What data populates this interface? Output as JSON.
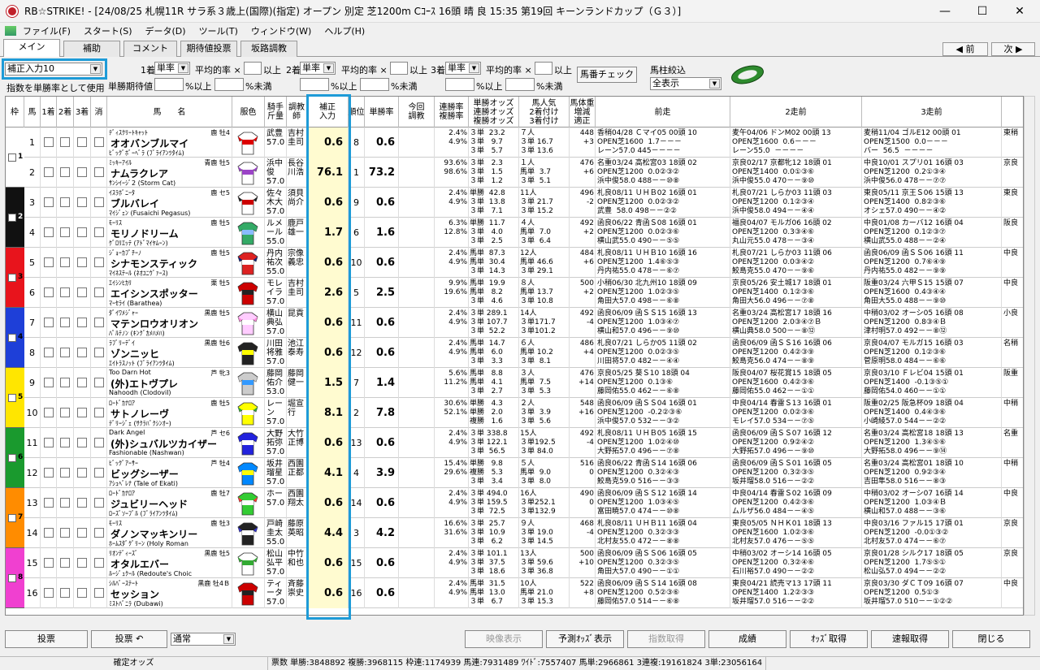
{
  "window": {
    "title": "RB☆STRIKE! - [24/08/25 札幌11R サラ系３歳上(国際)(指定) オープン 別定 芝1200m Cｺｰｽ 16頭 晴 良 15:35 第19回 キーンランドカップ（Ｇ３）]",
    "min": "—",
    "max": "☐",
    "close": "✕"
  },
  "menu": [
    "ファイル(F)",
    "スタート(S)",
    "データ(D)",
    "ツール(T)",
    "ウィンドウ(W)",
    "ヘルプ(H)"
  ],
  "tabs": [
    "メイン",
    "補助",
    "コメント",
    "期待値投票",
    "坂路調教"
  ],
  "nav": {
    "prev": "◀ 前",
    "next": "次 ▶"
  },
  "controls": {
    "index_select": "補正入力10",
    "use_as_odds": "指数を単勝率として使用",
    "place1": "1着",
    "place2": "2着",
    "place3": "3着",
    "bet1": "単率",
    "bet2": "単率",
    "bet3": "単率",
    "avg_label": "平均的率 ×",
    "over": "以上",
    "exp_label": "単勝期待値",
    "pct_over": "%以上",
    "pct_under": "%未満",
    "check_btn": "馬番チェック",
    "filter_label": "馬柱絞込",
    "filter_select": "全表示"
  },
  "headers": {
    "waku": "枠",
    "uma": "馬",
    "p1": "1着",
    "p2": "2着",
    "p3": "3着",
    "kesu": "消",
    "horse": "馬　　名",
    "silk": "服色",
    "jockey": "騎手\n斤量",
    "trainer": "調教\n師",
    "index": "補正\n入力",
    "rank": "順位",
    "win": "単勝率",
    "today": "今回\n調教",
    "rate": "連勝率\n複勝率",
    "odds_type": "単勝オッズ\n連勝オッズ\n複勝オッズ",
    "pop": "馬人気\n2着付け\n3着付け",
    "wt": "馬体重\n増減\n適正",
    "prev1": "前走",
    "prev2": "2走前",
    "prev3": "3走前"
  },
  "horses": [
    {
      "waku": "1",
      "num": "1",
      "sire": "ﾃﾞｨｽｸﾘｰﾄｷｬｯﾄ",
      "sex": "鹿 牡4",
      "name": "オオバンブルマイ",
      "dam": "ﾋﾞｯｸﾞﾎﾞｰﾍﾞﾗ (ﾌﾞﾗｲｱﾝﾂﾀｲﾑ)",
      "jockey": "武豊",
      "kin": "57.0",
      "trainer": "吉村\n圭司",
      "index": "0.6",
      "rank": "8",
      "win": "0.6",
      "rate": "2.4%\n4.9%",
      "odds": "３単  23.2\n３単   9.7\n３単   5.7",
      "pop": "７人\n３単 16.7\n３単 13.6",
      "wt": "448\n+3",
      "p1": "香稍04/28 Ｃマイ05 00頭 10\nOPEN芝1600  1.7－－－\nレーン57.0 445－－－－",
      "p2": "麦午04/06 ドンM02 00頭 13\nOPEN芝1600  0.6－－－\nレーン55.0  －－－－",
      "p3": "麦稍11/04 ゴルE12 00頭 01\nOPEN芝1500  0.0－－－\nバー  56.5  －－－－"
    },
    {
      "waku": "1",
      "num": "2",
      "sire": "ﾐｯｷｰｱｲﾙ",
      "sex": "青鹿 牡5",
      "name": "ナムラクレア",
      "dam": "ｻﾝｼｲｰｼﾞ2 (Storm Cat)",
      "jockey": "浜中\n俊",
      "kin": "57.0",
      "trainer": "長谷\n川浩",
      "index": "76.1",
      "rank": "1",
      "win": "73.2",
      "rate": "93.6%\n98.6%",
      "odds": "３単   2.3\n３単   1.5\n３単   1.2",
      "pop": "１人\n馬単  3.7\n３単  5.1",
      "wt": "476\n+6",
      "p1": "名重03/24 高松宮03 18頭 02\nOPEN芝1200  0.0②③②\n浜中俊58.0 488－－⑩⑧",
      "p2": "京良02/17 京都牝12 18頭 01\nOPEN芝1400  0.0①③⑥\n浜中俊55.0 470－－⑨⑩",
      "p3": "中良10/01 スプリ01 16頭 03\nOPEN芝1200  0.2①③④\n浜中俊56.0 478－－⑦⑦"
    },
    {
      "waku": "2",
      "num": "3",
      "sire": "ｲｽﾗﾎﾞﾆｰﾀ",
      "sex": "鹿 セ5",
      "name": "ブルバレイ",
      "dam": "ﾏｲｼﾞｪﾝ (Fusaichi Pegasus)",
      "jockey": "佐々\n木大",
      "kin": "57.0",
      "trainer": "須貝\n尚介",
      "index": "0.6",
      "rank": "9",
      "win": "0.6",
      "rate": "2.4%\n4.9%",
      "odds": "単勝  42.8\n３単  13.8\n３単   7.1",
      "pop": "11人\n３単 21.7\n３単 15.2",
      "wt": "496\n-2",
      "p1": "札良08/11 ＵＨＢ02 16頭 01\nOPEN芝1200  0.0②③②\n武豊  58.0 498－－②②",
      "p2": "札良07/21 しらか03 11頭 03\nOPEN芝1200  0.1②③④\n浜中俊58.0 494－－④④",
      "p3": "東良05/11 京王Ｓ06 15頭 13\nOPEN芝1400  0.8②③⑥\nオシェ57.0 490－－④②"
    },
    {
      "waku": "2",
      "num": "4",
      "sire": "ﾓｰﾘｽ",
      "sex": "鹿 牡5",
      "name": "モリノドリーム",
      "dam": "ｹﾞﾛﾘｴｯﾃ (ｱﾄﾞﾏｲﾔﾑｰﾝ)",
      "jockey": "ルメ\nール",
      "kin": "55.0",
      "trainer": "鹿戸\n雄一",
      "index": "1.7",
      "rank": "6",
      "win": "1.6",
      "rate": "6.3%\n12.8%",
      "odds": "単勝  11.7\n３単   4.0\n３単   2.5",
      "pop": "４人\n馬単  7.0\n３単  6.4",
      "wt": "492\n+2",
      "p1": "函良06/22 青函Ｓ08 16頭 01\nOPEN芝1200  0.0②③⑥\n横山武55.0 490－－⑤⑤",
      "p2": "福良04/07 モルガ06 16頭 02\nOPEN芝1200  0.3③④⑥\n丸山元55.0 478－－③④",
      "p3": "中良01/08 カーバ12 16頭 04\nOPEN芝1200  0.1②③⑦\n横山武55.0 488－－②④"
    },
    {
      "waku": "3",
      "num": "5",
      "sire": "ｼﾞｮｰｶﾌﾟﾁｰﾉ",
      "sex": "鹿 牡5",
      "name": "シナモンスティック",
      "dam": "ﾏｲﾈｽﾃｰﾙ (ﾈｵﾕﾆｳﾞｧｰｽ)",
      "jockey": "丹内\n祐次",
      "kin": "55.0",
      "trainer": "宗像\n義忠",
      "index": "0.6",
      "rank": "10",
      "win": "0.6",
      "rate": "2.4%\n4.9%",
      "odds": "馬単  87.3\n馬単  30.4\n３単  14.3",
      "pop": "12人\n馬単 46.6\n３単 29.1",
      "wt": "484\n+6",
      "p1": "札良08/11 ＵＨＢ10 16頭 16\nOPEN芝1200  1.4⑥⑤③\n丹内祐55.0 478－－⑥⑦",
      "p2": "札良07/21 しらか03 11頭 06\nOPEN芝1200  0.0③④②\n鮫島克55.0 470－－⑨⑥",
      "p3": "函良06/09 函ＳＳ06 16頭 11\nOPEN芝1200  0.7⑥④⑨\n丹内祐55.0 482－－⑨⑨"
    },
    {
      "waku": "3",
      "num": "6",
      "sire": "ｴｲｼﾝﾋｶﾘ",
      "sex": "栗 牡5",
      "name": "エイシンスポッター",
      "dam": "ﾏｰｾﾗｲ (Barathea)",
      "jockey": "モレ\nイラ",
      "kin": "57.0",
      "trainer": "吉村\n圭司",
      "index": "2.6",
      "rank": "5",
      "win": "2.5",
      "rate": "9.9%\n19.6%",
      "odds": "馬単  19.9\n馬単   8.2\n３単   4.6",
      "pop": "８人\n馬単 13.7\n３単 10.8",
      "wt": "500\n+2",
      "p1": "小稍06/30 北九州10 18頭 09\nOPEN芝1200  1.0②③⑤\n角田大57.0 498－－⑥⑧",
      "p2": "京良05/26 安土城17 18頭 01\nOPEN芝1400  0.1②③⑥\n角田大56.0 496－－⑦⑧",
      "p3": "阪重03/24 六甲Ｓ15 15頭 07\nOPEN芝1600  0.4③④④\n角田大55.0 488－－⑨⑩"
    },
    {
      "waku": "4",
      "num": "7",
      "sire": "ﾀﾞｲﾜﾒｼﾞｬｰ",
      "sex": "黒鹿 牡5",
      "name": "マテンロウオリオン",
      "dam": "ﾊﾟﾙﾃﾉﾝ (ｷﾝｸﾞｶﾒﾊﾒﾊ)",
      "jockey": "横山\n典弘",
      "kin": "57.0",
      "trainer": "昆貢",
      "index": "0.6",
      "rank": "11",
      "win": "0.6",
      "rate": "2.4%\n4.9%",
      "odds": "３単 289.1\n３単 107.7\n３単  52.2",
      "pop": "14人\n３単171.7\n３単101.2",
      "wt": "492\n-4",
      "p1": "函良06/09 函ＳＳ15 16頭 13\nOPEN芝1200  1.0③④⑦\n横山和57.0 496－－⑨⑩",
      "p2": "名重03/24 高松宮17 18頭 16\nOPEN芝1200  2.0③④⑦Ｂ\n横山典58.0 500－－⑧⑫",
      "p3": "中稍03/02 オーシ05 16頭 08\nOPEN芝1200  0.8③④Ｂ\n津村明57.0 492－－⑧⑫"
    },
    {
      "waku": "4",
      "num": "8",
      "sire": "ﾗﾌﾞﾘｰﾃﾞｲ",
      "sex": "黒鹿 牡6",
      "name": "ゾンニッヒ",
      "dam": "ｴｲﾄﾗｽﾉｯﾄ (ﾌﾞﾗｲｱﾝﾂﾀｲﾑ)",
      "jockey": "川田\n将雅",
      "kin": "57.0",
      "trainer": "池江\n泰寿",
      "index": "0.6",
      "rank": "12",
      "win": "0.6",
      "rate": "2.4%\n4.9%",
      "odds": "馬単  14.7\n馬単   6.0\n３単   3.3",
      "pop": "６人\n馬単 10.2\n３単  8.1",
      "wt": "486\n+4",
      "p1": "札良07/21 しらか05 11頭 02\nOPEN芝1200  0.0②③⑤\n川田将57.0 482－－④④",
      "p2": "函良06/09 函ＳＳ16 16頭 06\nOPEN芝1200  0.4②③⑨\n鮫島克56.0 474－－⑧⑨",
      "p3": "京良04/07 モルガ15 16頭 03\nOPEN芝1200  0.1②③⑥\n菅原明58.0 484－－⑥⑥"
    },
    {
      "waku": "5",
      "num": "9",
      "sire": "Too Darn Hot",
      "sex": "芦 牝3",
      "name": "(外)エトヴプレ",
      "dam": "Nahoodh (Clodovil)",
      "jockey": "藤岡\n佑介",
      "kin": "53.0",
      "trainer": "藤岡\n健一",
      "index": "1.5",
      "rank": "7",
      "win": "1.4",
      "rate": "5.6%\n11.2%",
      "odds": "馬単   8.8\n馬単   4.1\n３単   2.7",
      "pop": "３人\n馬単  7.5\n３単  5.3",
      "wt": "476\n+14",
      "p1": "京良05/25 葵Ｓ10 18頭 04\nOPEN芝1200  0.1③⑥\n藤岡佑55.0 462－－⑥⑧",
      "p2": "阪良04/07 桜花賞15 18頭 05\nOPEN芝1600  0.4②③⑥\n藤岡佑55.0 462－－①①",
      "p3": "京良03/10 Ｆレビ04 15頭 01\nOPEN芝1400  -0.1③⑤①\n藤岡佑54.0 460－－①①"
    },
    {
      "waku": "5",
      "num": "10",
      "sire": "ﾛｰﾄﾞｶﾅﾛｱ",
      "sex": "鹿 牡5",
      "name": "サトノレーヴ",
      "dam": "ﾃﾞﾘｰｼﾞｪ (ｻｸﾗﾊﾞｸｼﾝｵｰ)",
      "jockey": "レー\nン",
      "kin": "57.0",
      "trainer": "堀宣\n行",
      "index": "8.1",
      "rank": "2",
      "win": "7.8",
      "rate": "30.6%\n52.1%",
      "odds": "単勝   4.3\n単勝   2.0\n複勝   1.6",
      "pop": "２人\n３単  3.9\n３単  5.6",
      "wt": "548\n+16",
      "p1": "函良06/09 函ＳＳ04 16頭 01\nOPEN芝1200  -0.2②③⑥\n浜中俊57.0 532－－③②",
      "p2": "中良04/14 春雷Ｓ13 16頭 01\nOPEN芝1200  0.0②③⑥\nモレイ57.0 534－－⑦⑤",
      "p3": "阪重02/25 阪急杯09 18頭 04\nOPEN芝1400  0.4④③⑥\n小崎綾57.0 544－－②②"
    },
    {
      "waku": "6",
      "num": "11",
      "sire": "Dark Angel",
      "sex": "芦 セ6",
      "name": "(外)シュバルツカイザー",
      "dam": "Fashionable (Nashwan)",
      "jockey": "大野\n拓弥",
      "kin": "57.0",
      "trainer": "大竹\n正博",
      "index": "0.6",
      "rank": "13",
      "win": "0.6",
      "rate": "2.4%\n4.9%",
      "odds": "３単 338.8\n３単 122.1\n３単  56.5",
      "pop": "15人\n３単192.5\n３単 84.0",
      "wt": "492\n-4",
      "p1": "札良08/11 ＵＨＢ05 16頭 15\nOPEN芝1200  1.0②④⑩\n大野拓57.0 496－－⑦⑧",
      "p2": "函良06/09 函ＳＳ07 16頭 12\nOPEN芝1200  0.9②④②\n大野拓57.0 496－－⑨⑩",
      "p3": "名重03/24 高松宮18 18頭 13\nOPEN芝1200  1.3④⑤⑥\n大野拓58.0 496－－⑨⑭"
    },
    {
      "waku": "6",
      "num": "12",
      "sire": "ﾋﾞｯｸﾞｱｰｻｰ",
      "sex": "芦 牡4",
      "name": "ビッグシーザー",
      "dam": "ｱｼｭﾍﾞﾚﾅ (Tale of Ekati)",
      "jockey": "坂井\n瑠星",
      "kin": "57.0",
      "trainer": "西園\n正都",
      "index": "4.1",
      "rank": "4",
      "win": "3.9",
      "rate": "15.4%\n29.6%",
      "odds": "単勝   9.8\n複勝   5.3\n３単   3.4",
      "pop": "５人\n馬単  9.0\n３単  8.0",
      "wt": "516\n0",
      "p1": "函良06/22 青函Ｓ14 16頭 06\nOPEN芝1200  0.3②④③\n鮫島克59.0 516－－③③",
      "p2": "函良06/09 函ＳＳ01 16頭 05\nOPEN芝1200  0.3②③⑤\n坂井瑠58.0 516－－②②",
      "p3": "名重03/24 高松宮01 18頭 10\nOPEN芝1200  0.9②③④\n吉田隼58.0 516－－⑧③"
    },
    {
      "waku": "7",
      "num": "13",
      "sire": "ﾛｰﾄﾞｶﾅﾛｱ",
      "sex": "鹿 牡7",
      "name": "ジュビリーヘッド",
      "dam": "ﾛｰｽﾞｿｰﾌﾞﾙ (ﾌﾞﾗｲｱﾝﾂﾀｲﾑ)",
      "jockey": "ホー",
      "kin": "57.0",
      "trainer": "西園\n翔太",
      "index": "0.6",
      "rank": "14",
      "win": "0.6",
      "rate": "2.4%\n4.9%",
      "odds": "３単 494.0\n３単 159.5\n３単  72.5",
      "pop": "16人\n３単252.1\n３単132.9",
      "wt": "490\n0",
      "p1": "函良06/09 函ＳＳ12 16頭 14\nOPEN芝1200  1.0③④⑤\n富田暁57.0 474－－⑩⑧",
      "p2": "中良04/14 春雷Ｓ02 16頭 09\nOPEN芝1200  0.4②③⑥\nムルザ56.0 484－－④⑤",
      "p3": "中稍03/02 オーシ07 16頭 14\nOPEN芝1200  1.0③④Ｂ\n横山和57.0 488－－③⑥"
    },
    {
      "waku": "7",
      "num": "14",
      "sire": "ﾓｰﾘｽ",
      "sex": "鹿 牡3",
      "name": "ダノンマッキンリー",
      "dam": "ﾎｰﾑｽﾀﾞｸﾞﾘｰﾝ (Holy Roman",
      "jockey": "戸崎\n圭太",
      "kin": "55.0",
      "trainer": "藤原\n英昭",
      "index": "4.4",
      "rank": "3",
      "win": "4.2",
      "rate": "16.6%\n31.6%",
      "odds": "３単  25.7\n３単  10.9\n３単   6.2",
      "pop": "９人\n３単 19.0\n３単 14.5",
      "wt": "468\n-4",
      "p1": "札良08/11 ＵＨＢ11 16頭 04\nOPEN芝1200  0.3②③③\n北村友55.0 472－－⑧⑧",
      "p2": "東良05/05 ＮＨＫ01 18頭 13\nOPEN芝1600  1.0②③⑥\n北村友57.0 476－－⑤⑤",
      "p3": "中良03/16 ファル15 17頭 01\nOPEN芝1200  -0.0①③②\n北村友57.0 474－－⑥⑦"
    },
    {
      "waku": "8",
      "num": "15",
      "sire": "ﾘｵﾝﾃﾞｨｰｽﾞ",
      "sex": "黒鹿 牡5",
      "name": "オタルエバー",
      "dam": "ﾙｰｼﾞｭｸｰﾙ (Redoute's Choic",
      "jockey": "松山\n弘平",
      "kin": "57.0",
      "trainer": "中竹\n和也",
      "index": "0.6",
      "rank": "15",
      "win": "0.6",
      "rate": "2.4%\n4.9%",
      "odds": "３単 101.1\n３単  37.5\n３単  18.6",
      "pop": "13人\n３単 59.6\n３単 36.8",
      "wt": "500\n+10",
      "p1": "函良06/09 函ＳＳ06 16頭 05\nOPEN芝1200  0.3②③⑤\n角田大57.0 490－－①①",
      "p2": "中稍03/02 オーシ14 16頭 05\nOPEN芝1200  0.3②④⑥\n石川裕57.0 490－－②②",
      "p3": "京良01/28 シルク17 18頭 05\nOPEN芝1200  1.7⑤⑤①\n松山弘57.0 494－－②②"
    },
    {
      "waku": "8",
      "num": "16",
      "sire": "ｼﾙﾊﾞｰｽﾃｰﾄ",
      "sex": "黒鹿 牡4Ｂ",
      "name": "セッション",
      "dam": "ﾐｽﾄﾊﾞﾆﾗ (Dubawi)",
      "jockey": "ティ\nータ",
      "kin": "57.0",
      "trainer": "斉藤\n崇史",
      "index": "0.6",
      "rank": "16",
      "win": "0.6",
      "rate": "2.4%\n4.9%",
      "odds": "馬単  31.5\n馬単  13.0\n３単   6.7",
      "pop": "10人\n馬単 21.0\n３単 15.3",
      "wt": "522\n+8",
      "p1": "函良06/09 函ＳＳ14 16頭 08\nOPEN芝1200  0.5②③⑥\n藤岡佑57.0 514－－⑥⑧",
      "p2": "東良04/21 読売マ13 17頭 11\nOPEN芝1400  1.2②③③\n坂井瑠57.0 516－－②②",
      "p3": "京良03/30 ダＣＴ09 16頭 07\nOPEN芝1200  0.5①③\n坂井瑠57.0 510－－①②②"
    }
  ],
  "waku_colors": {
    "1": "#ffffff",
    "2": "#111111",
    "3": "#e8141c",
    "4": "#1e3fd8",
    "5": "#ffe600",
    "6": "#1a9a2e",
    "7": "#ff8c00",
    "8": "#f040d0"
  },
  "bottom": {
    "vote": "投票",
    "vote2": "投票 ↶",
    "mode": "通常",
    "video": "映像表示",
    "pred": "予測ｵｯｽﾞ表示",
    "index_get": "指数取得",
    "result": "成績",
    "odds_get": "ｵｯｽﾞ取得",
    "flash": "速報取得",
    "close": "閉じる"
  },
  "status": [
    "確定オッズ",
    "票数  単勝:3848892  複勝:3968115  枠連:1174939  馬連:7931489  ﾜｲﾄﾞ:7557407  馬単:2966861  3連複:19161824  3単:23056164"
  ],
  "right_edge": [
    "東稍",
    "京良",
    "東良",
    "阪良",
    "中良",
    "中良",
    "小良",
    "名稍",
    "阪重",
    "中稍",
    "名重",
    "中稍",
    "中良",
    "京良",
    "京良",
    "中良"
  ]
}
